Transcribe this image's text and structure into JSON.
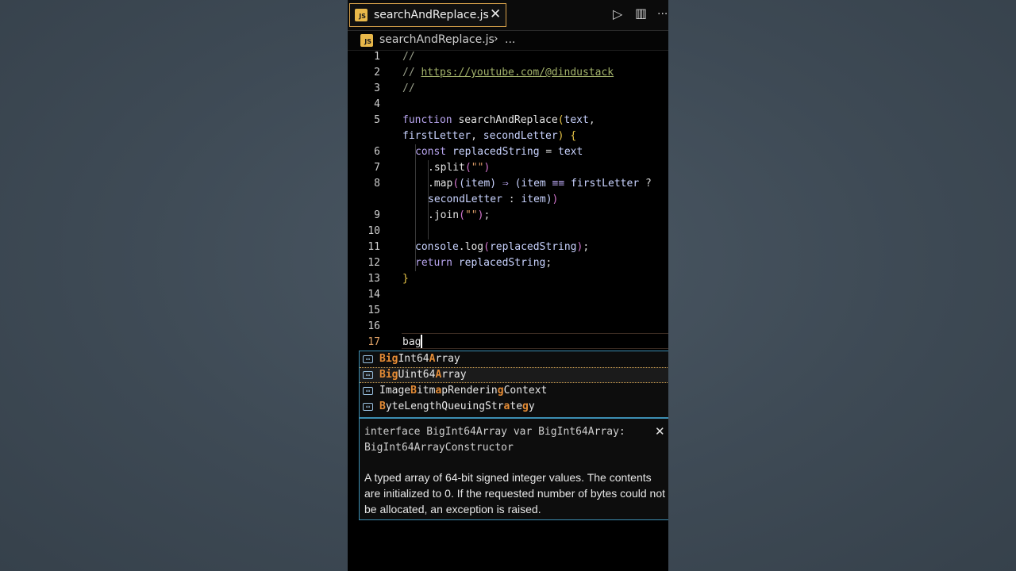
{
  "tab": {
    "label": "searchAndReplace.js",
    "close": "✕",
    "badge": "JS"
  },
  "toolbar": {
    "run": "▷",
    "split": "▥",
    "more": "···"
  },
  "breadcrumb": {
    "file": "searchAndReplace.js",
    "chevron": "›",
    "more": "..."
  },
  "lines": [
    "1",
    "2",
    "3",
    "4",
    "5",
    "6",
    "7",
    "8",
    "9",
    "10",
    "11",
    "12",
    "13",
    "14",
    "15",
    "16",
    "17"
  ],
  "code": {
    "l1": "//",
    "l2_pre": "// ",
    "l2_url": "https://youtube.com/@dindustack",
    "l3": "//",
    "l5_kw": "function",
    "l5_name": "searchAndReplace",
    "l5_paren": "(",
    "l5_p1": "text",
    "l5_comma": ",",
    "l5b_p2": "firstLetter",
    "l5b_comma": ", ",
    "l5b_p3": "secondLetter",
    "l5b_close": ")",
    "l5b_brace": " {",
    "l6_kw": "const ",
    "l6_var": "replacedString",
    "l6_eq": " = ",
    "l6_val": "text",
    "l7_dot": ".split",
    "l7_p": "(",
    "l7_str": "\"\"",
    "l7_pc": ")",
    "l8_dot": ".map",
    "l8_p": "(",
    "l8_p2": "(",
    "l8_item": "item",
    "l8_pc": ")",
    "l8_arrow": " ⇒ ",
    "l8_p3": "(",
    "l8_item2": "item",
    "l8_eq": " ≡≡ ",
    "l8_fl": "firstLetter",
    "l8_q": " ?",
    "l8b_sl": "secondLetter",
    "l8b_colon": " : ",
    "l8b_item": "item",
    "l8b_pc": ")",
    "l8b_pc2": ")",
    "l9_dot": ".join",
    "l9_p": "(",
    "l9_str": "\"\"",
    "l9_pc": ")",
    "l9_semi": ";",
    "l11_obj": "console",
    "l11_dot": ".log",
    "l11_p": "(",
    "l11_arg": "replacedString",
    "l11_pc": ")",
    "l11_semi": ";",
    "l12_kw": "return ",
    "l12_var": "replacedString",
    "l12_semi": ";",
    "l13": "}",
    "l17": "bag"
  },
  "suggest": [
    {
      "parts": [
        [
          "B",
          1
        ],
        [
          "ig",
          1
        ],
        [
          "Int64",
          0
        ],
        [
          "A",
          1
        ],
        [
          "rray",
          0
        ]
      ]
    },
    {
      "parts": [
        [
          "B",
          1
        ],
        [
          "ig",
          1
        ],
        [
          "Uint64",
          0
        ],
        [
          "A",
          1
        ],
        [
          "rray",
          0
        ]
      ]
    },
    {
      "parts": [
        [
          "Image",
          0
        ],
        [
          "B",
          1
        ],
        [
          "itm",
          0
        ],
        [
          "a",
          1
        ],
        [
          "pRenderin",
          0
        ],
        [
          "g",
          1
        ],
        [
          "Context",
          0
        ]
      ]
    },
    {
      "parts": [
        [
          "B",
          1
        ],
        [
          "yteLengthQueuingStr",
          0
        ],
        [
          "a",
          1
        ],
        [
          "te",
          0
        ],
        [
          "g",
          1
        ],
        [
          "y",
          0
        ]
      ]
    }
  ],
  "details": {
    "signature": "interface BigInt64Array var BigInt64Array: BigInt64ArrayConstructor",
    "doc": "A typed array of 64-bit signed integer values. The contents are initialized to 0. If the requested number of bytes could not be allocated, an exception is raised.",
    "close": "✕"
  }
}
